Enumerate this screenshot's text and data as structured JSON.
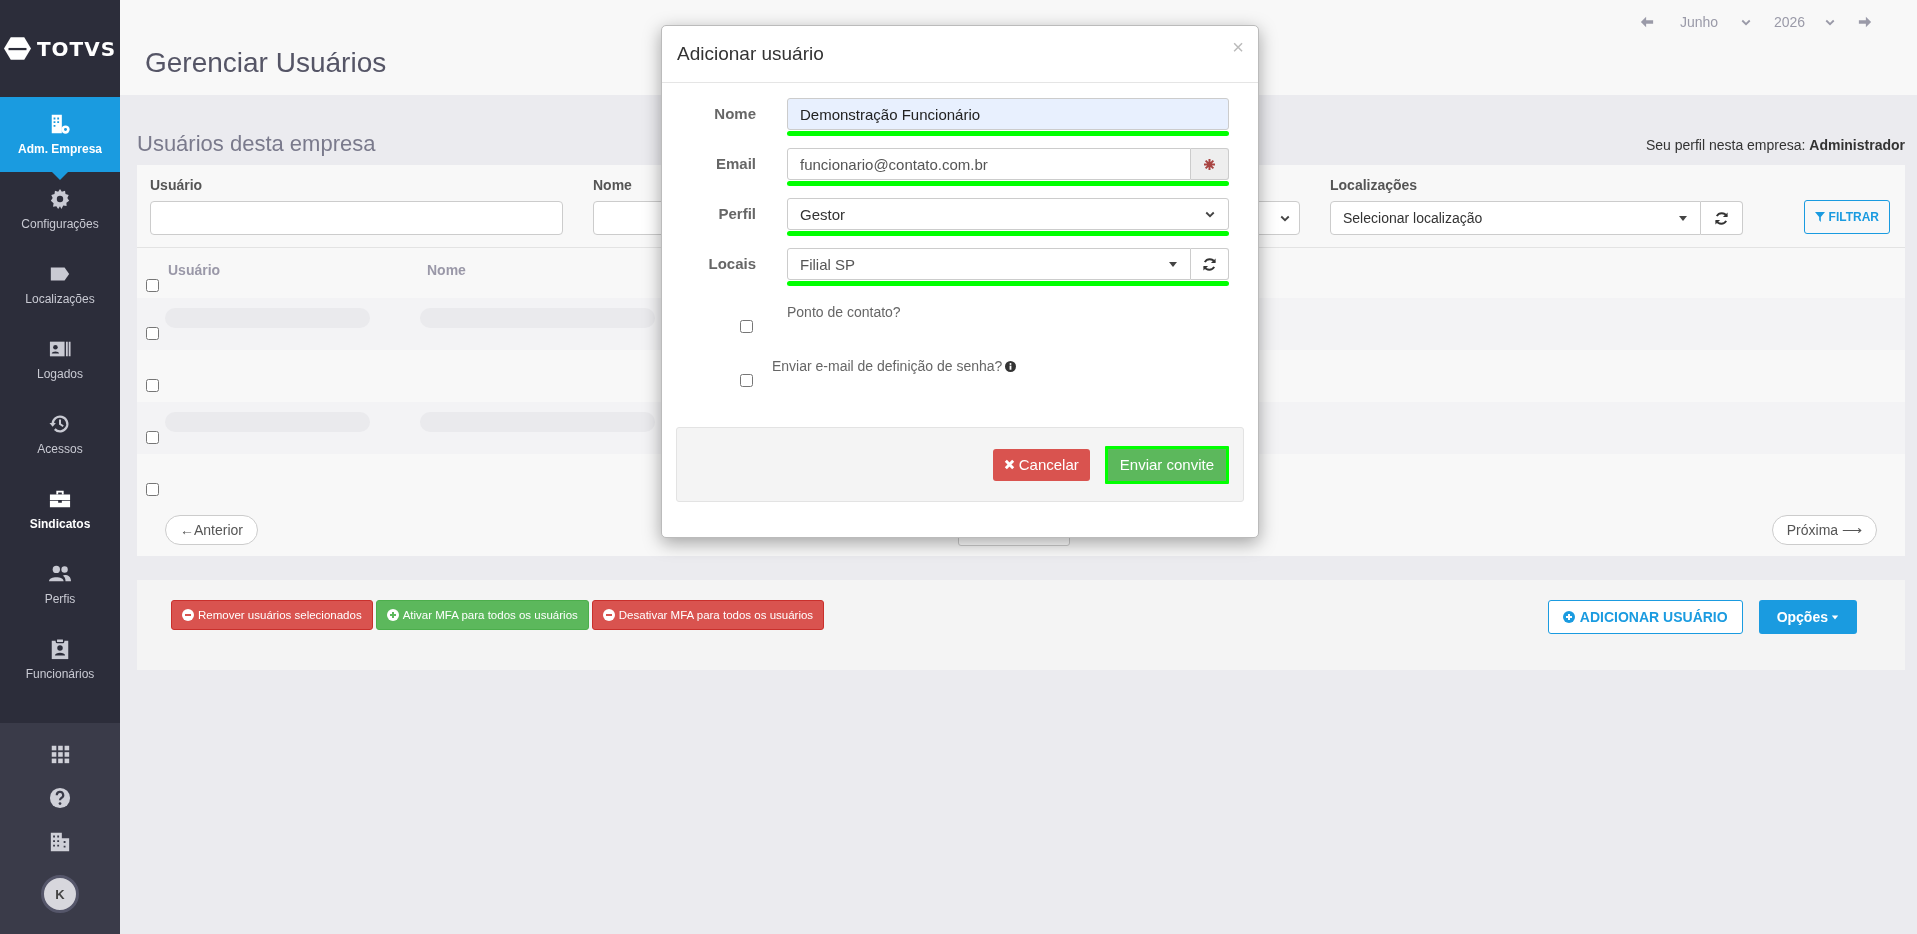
{
  "sidebar": {
    "logo": "TOTVS",
    "items": [
      {
        "label": "Adm. Empresa",
        "selected": true,
        "hover": false
      },
      {
        "label": "Configurações",
        "selected": false,
        "hover": false
      },
      {
        "label": "Localizações",
        "selected": false,
        "hover": false
      },
      {
        "label": "Logados",
        "selected": false,
        "hover": false
      },
      {
        "label": "Acessos",
        "selected": false,
        "hover": false
      },
      {
        "label": "Sindicatos",
        "selected": false,
        "hover": true
      },
      {
        "label": "Perfis",
        "selected": false,
        "hover": false
      },
      {
        "label": "Funcionários",
        "selected": false,
        "hover": false
      }
    ],
    "avatar": "K"
  },
  "header": {
    "title": "Gerenciar Usuários",
    "month": "Junho",
    "year": "2026"
  },
  "section": {
    "title": "Usuários desta empresa",
    "profile": "Seu perfil nesta empresa: **Administrador**"
  },
  "filters": [
    {
      "kind": "input",
      "label": "Usuário"
    },
    {
      "kind": "input",
      "label": "Nome"
    },
    {
      "kind": "select"
    },
    {
      "kind": "location",
      "label": "Localizações",
      "value": "Selecionar localização"
    }
  ],
  "filter_button": "FILTRAR",
  "table": {
    "columns": [
      "Usuário",
      "Nome"
    ],
    "header_checked": false,
    "rows": [
      {
        "checked": false,
        "loading": true
      },
      {
        "checked": false,
        "loading": false
      },
      {
        "checked": false,
        "loading": true
      },
      {
        "checked": false,
        "loading": false
      }
    ]
  },
  "pagination": {
    "previous": "←Anterior",
    "next": "Próxima ⟶"
  },
  "actions": [
    {
      "kind": "danger",
      "label": "Remover usuários selecionados"
    },
    {
      "kind": "success",
      "label": "Ativar MFA para todos os usuários"
    },
    {
      "kind": "danger",
      "label": "Desativar MFA para todos os usuários"
    }
  ],
  "add_user": "ADICIONAR USUÁRIO",
  "options": "Opções",
  "modal": {
    "title": "Adicionar usuário",
    "close": "×",
    "fields": [
      {
        "kind": "text",
        "label": "Nome",
        "value": "Demonstração Funcionário",
        "highlighted": true
      },
      {
        "kind": "required",
        "label": "Email",
        "value": "funcionario@contato.com.br",
        "highlighted": true
      },
      {
        "kind": "select",
        "label": "Perfil",
        "value": "Gestor",
        "highlighted": true
      },
      {
        "kind": "multiselect",
        "label": "Locais",
        "value": "Filial SP",
        "highlighted": true
      }
    ],
    "checkboxes": [
      {
        "label": "Ponto de contato?",
        "checked": false,
        "info": false
      },
      {
        "label": "Enviar e-mail de definição de senha?",
        "checked": false,
        "info": true
      }
    ],
    "cancel": "Cancelar",
    "submit": {
      "label": "Enviar convite",
      "highlighted": true
    }
  }
}
